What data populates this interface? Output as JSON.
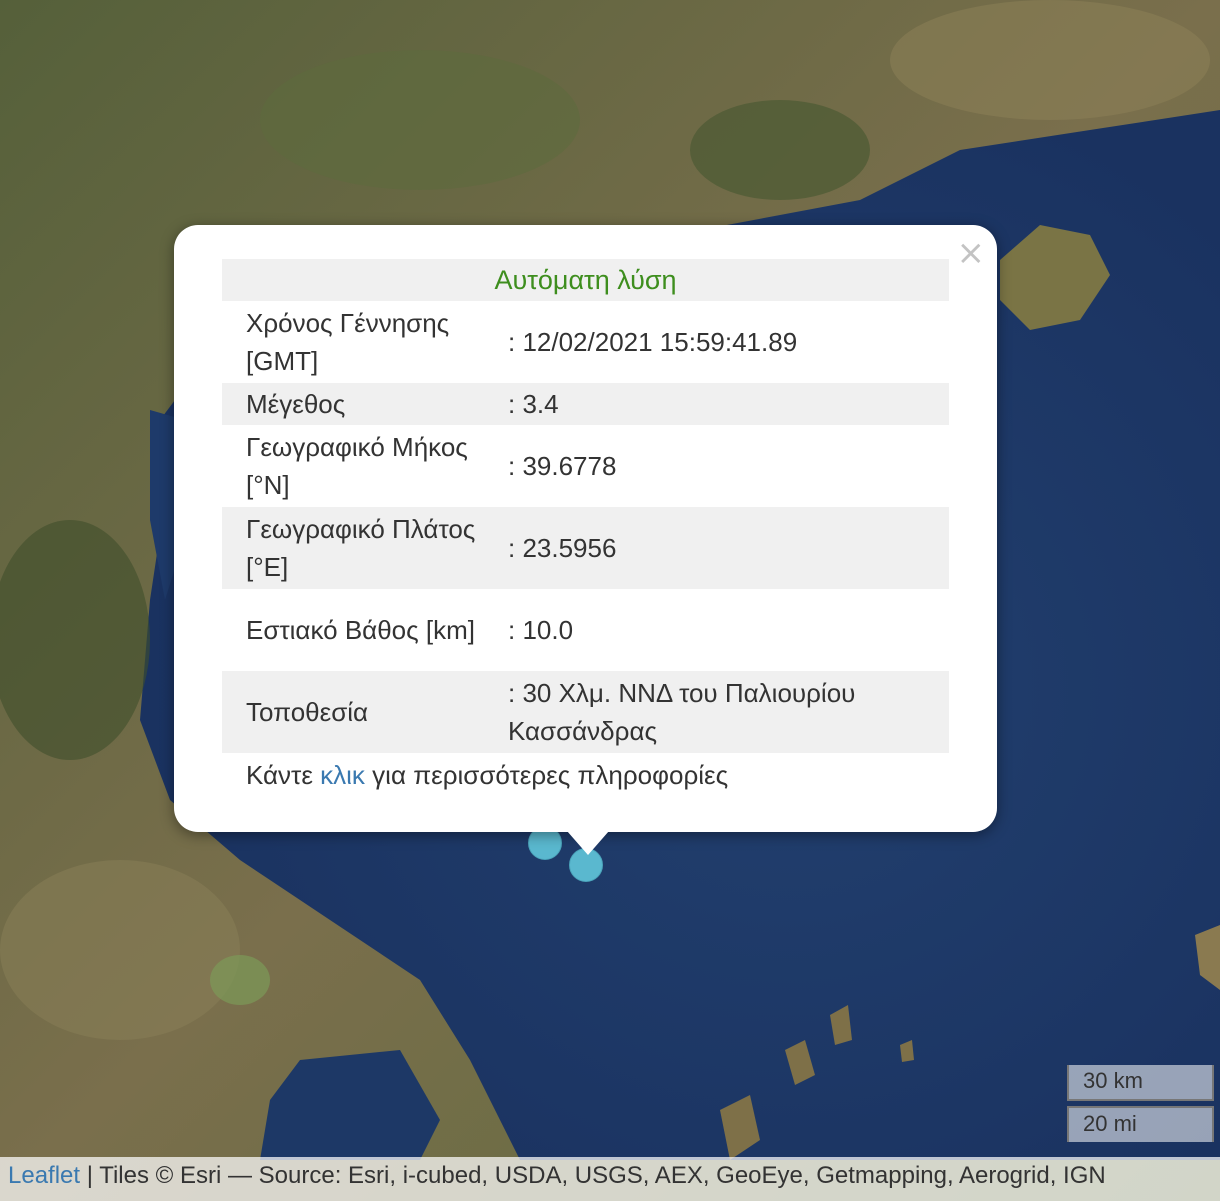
{
  "popup": {
    "title": "Αυτόματη λύση",
    "rows": [
      {
        "label": "Χρόνος Γέννησης [GMT]",
        "value": ": 12/02/2021 15:59:41.89"
      },
      {
        "label": "Μέγεθος",
        "value": ": 3.4"
      },
      {
        "label": "Γεωγραφικό Μήκος [°N]",
        "value": ": 39.6778"
      },
      {
        "label": "Γεωγραφικό Πλάτος [°E]",
        "value": ": 23.5956"
      },
      {
        "label": "Εστιακό Βάθος [km]",
        "value": ": 10.0"
      },
      {
        "label": "Τοποθεσία",
        "value": ": 30 Χλμ. ΝΝΔ του Παλιουρίου Κασσάνδρας"
      }
    ],
    "footer_prefix": "Κάντε",
    "footer_link": "κλικ",
    "footer_suffix": "για περισσότερες πληροφορίες",
    "close_symbol": "×"
  },
  "scale": {
    "km": "30 km",
    "mi": "20 mi"
  },
  "attribution": {
    "link": "Leaflet",
    "text": " | Tiles © Esri — Source: Esri, i-cubed, USDA, USGS, AEX, GeoEye, Getmapping, Aerogrid, IGN"
  },
  "colors": {
    "sea": "#1f3a6b",
    "land": "#6b6a43",
    "marker": "#5ab8cf",
    "title": "#3e8e1e",
    "link": "#3a79b0"
  }
}
